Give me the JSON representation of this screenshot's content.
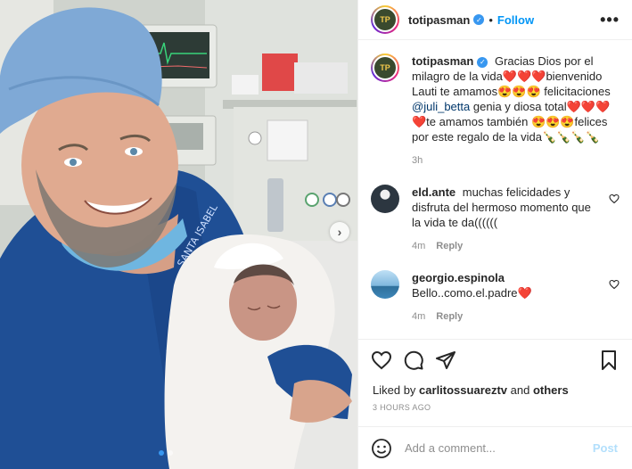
{
  "post": {
    "username": "totipasman",
    "follow_label": "Follow",
    "more_label": "•••",
    "verified_mark": "✓",
    "next_arrow": "›"
  },
  "caption": {
    "username": "totipasman",
    "text_1": "Gracias Dios por el milagro de la vida❤️❤️❤️bienvenido Lauti te amamos😍😍😍 felicitaciones ",
    "mention": "@juli_betta",
    "text_2": " genia y diosa total❤️❤️❤️❤️te amamos también 😍😍😍felices por este regalo de la vida🍾🍾🍾🍾",
    "time": "3h"
  },
  "comments": [
    {
      "username": "eld.ante",
      "text": "muchas felicidades y disfruta del hermoso momento que la vida te da((((((",
      "time": "4m",
      "reply_label": "Reply"
    },
    {
      "username": "georgio.espinola",
      "text": "Bello..como.el.padre❤️",
      "time": "4m",
      "reply_label": "Reply"
    }
  ],
  "likes": {
    "prefix": "Liked by ",
    "user": "carlitossuareztv",
    "and": " and ",
    "others": "others"
  },
  "timestamp": "3 HOURS AGO",
  "add_comment": {
    "placeholder": "Add a comment...",
    "post_label": "Post"
  },
  "colors": {
    "link": "#0095f6",
    "post_disabled": "#b2dffc",
    "mention": "#00376b",
    "secondary": "#8e8e8e",
    "scrubs": "#1e4d94"
  },
  "icons": [
    "heart-icon",
    "comment-icon",
    "share-icon",
    "bookmark-icon",
    "emoji-icon",
    "verified-icon",
    "more-options-icon",
    "next-arrow-icon"
  ]
}
